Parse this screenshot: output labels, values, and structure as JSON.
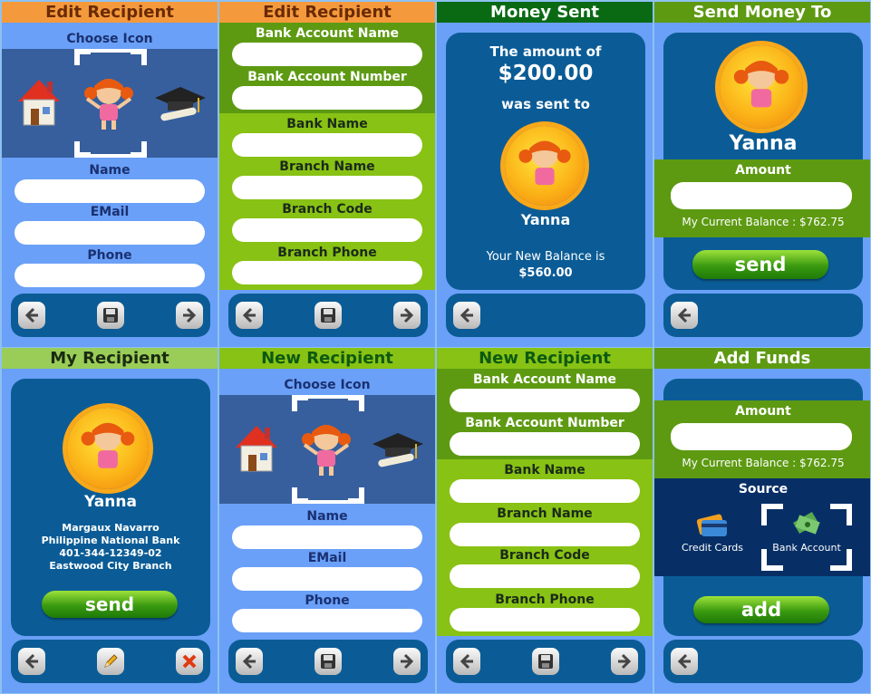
{
  "screens": {
    "edit_recipient_1": {
      "title": "Edit Recipient",
      "choose_icon": "Choose Icon",
      "name_label": "Name",
      "email_label": "EMail",
      "phone_label": "Phone"
    },
    "edit_recipient_2": {
      "title": "Edit Recipient",
      "bank_account_name": "Bank Account Name",
      "bank_account_number": "Bank Account Number",
      "bank_name": "Bank Name",
      "branch_name": "Branch Name",
      "branch_code": "Branch Code",
      "branch_phone": "Branch Phone"
    },
    "money_sent": {
      "title": "Money Sent",
      "line1": "The amount of",
      "amount": "$200.00",
      "line2": "was sent to",
      "recipient": "Yanna",
      "balance_label": "Your New Balance is",
      "balance": "$560.00"
    },
    "send_money_to": {
      "title": "Send Money To",
      "recipient": "Yanna",
      "amount_label": "Amount",
      "balance_text": "My Current Balance : $762.75",
      "send_label": "send"
    },
    "my_recipient": {
      "title": "My Recipient",
      "recipient": "Yanna",
      "detail_name": "Margaux Navarro",
      "detail_bank": "Philippine National Bank",
      "detail_account": "401-344-12349-02",
      "detail_branch": "Eastwood City Branch",
      "send_label": "send"
    },
    "new_recipient_1": {
      "title": "New Recipient",
      "choose_icon": "Choose Icon",
      "name_label": "Name",
      "email_label": "EMail",
      "phone_label": "Phone"
    },
    "new_recipient_2": {
      "title": "New Recipient",
      "bank_account_name": "Bank Account Name",
      "bank_account_number": "Bank Account Number",
      "bank_name": "Bank Name",
      "branch_name": "Branch Name",
      "branch_code": "Branch Code",
      "branch_phone": "Branch Phone"
    },
    "add_funds": {
      "title": "Add Funds",
      "amount_label": "Amount",
      "balance_text": "My Current Balance : $762.75",
      "source_label": "Source",
      "credit_cards": "Credit Cards",
      "bank_account": "Bank Account",
      "add_label": "add"
    }
  },
  "colors": {
    "accent_blue": "#0b5c96",
    "header_orange": "#f59a3c",
    "send_green": "#3a9a10"
  }
}
